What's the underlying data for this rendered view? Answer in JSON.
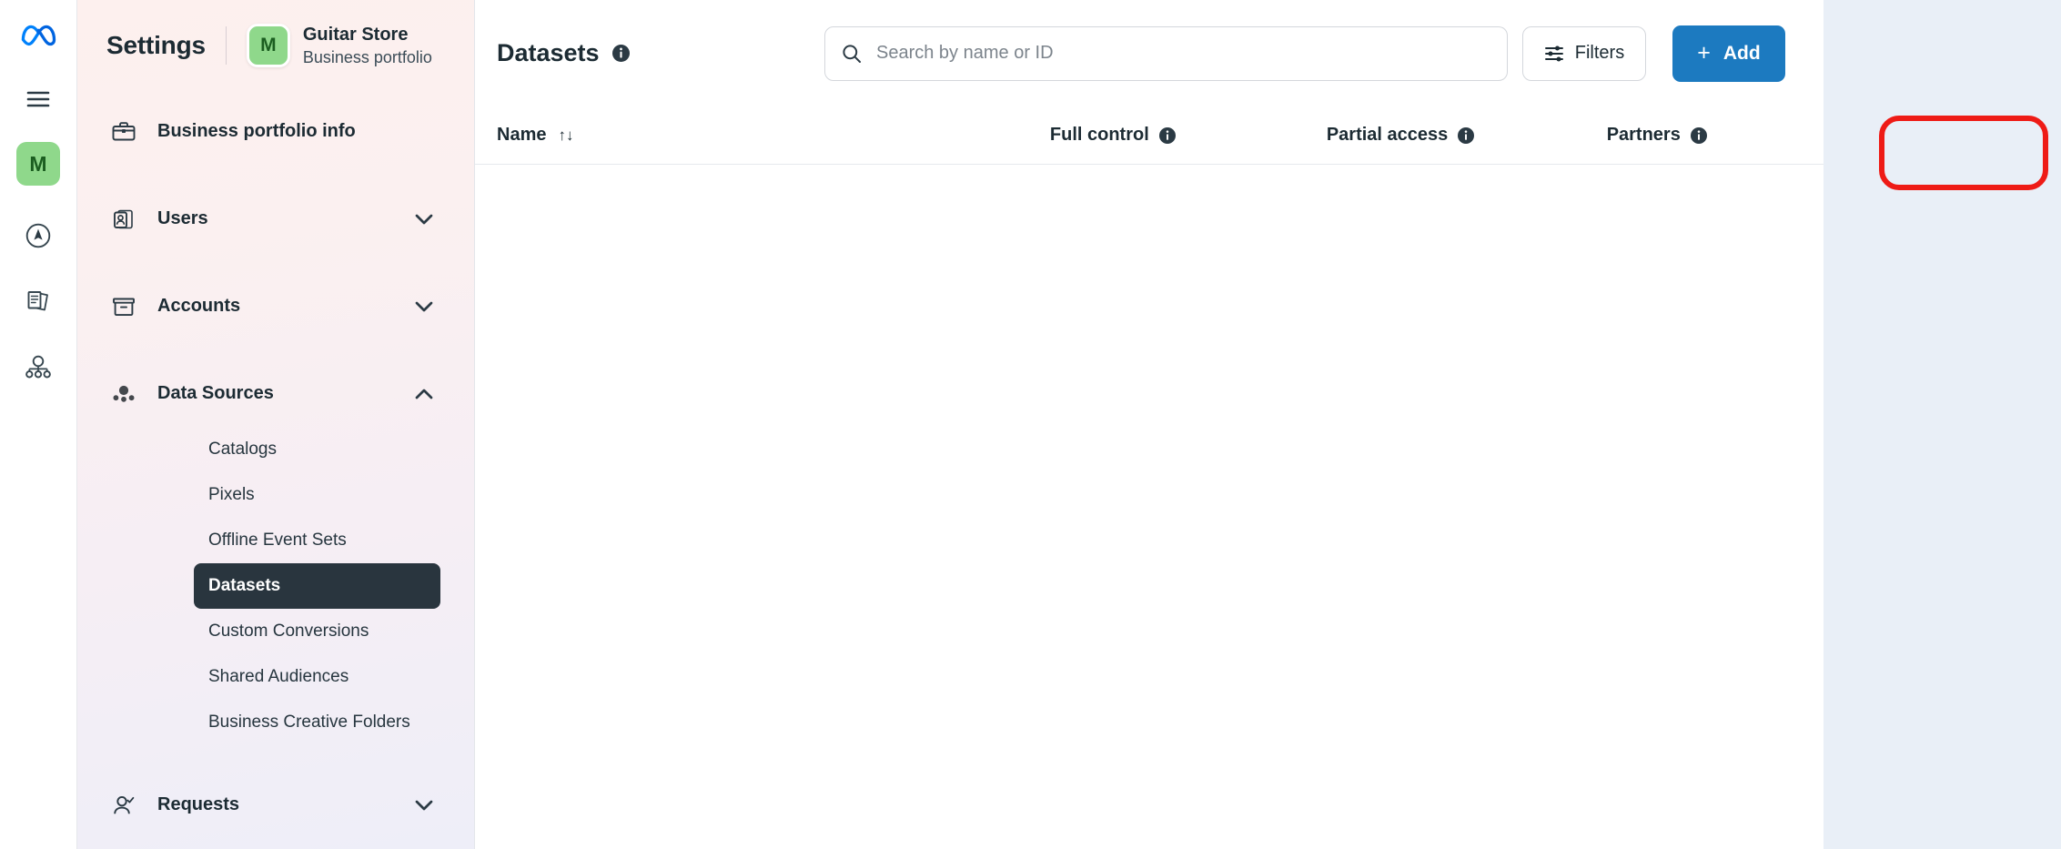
{
  "rail": {
    "logo": "meta-logo",
    "items": [
      {
        "name": "menu-icon",
        "label": "Menu"
      },
      {
        "name": "portfolio-avatar",
        "label": "M"
      },
      {
        "name": "compass-icon",
        "label": "Navigator"
      },
      {
        "name": "pages-icon",
        "label": "Pages"
      },
      {
        "name": "hierarchy-icon",
        "label": "Business structure"
      }
    ]
  },
  "header": {
    "title": "Settings",
    "portfolio_initial": "M",
    "portfolio_name": "Guitar Store",
    "portfolio_type": "Business portfolio"
  },
  "sidebar": {
    "items": [
      {
        "label": "Business portfolio info",
        "icon": "briefcase-icon",
        "expandable": false,
        "expanded": false
      },
      {
        "label": "Users",
        "icon": "id-card-icon",
        "expandable": true,
        "expanded": false
      },
      {
        "label": "Accounts",
        "icon": "box-icon",
        "expandable": true,
        "expanded": false
      },
      {
        "label": "Data Sources",
        "icon": "data-sources-icon",
        "expandable": true,
        "expanded": true
      },
      {
        "label": "Requests",
        "icon": "user-check-icon",
        "expandable": true,
        "expanded": false
      }
    ],
    "data_sources_children": [
      {
        "label": "Catalogs",
        "active": false
      },
      {
        "label": "Pixels",
        "active": false
      },
      {
        "label": "Offline Event Sets",
        "active": false
      },
      {
        "label": "Datasets",
        "active": true
      },
      {
        "label": "Custom Conversions",
        "active": false
      },
      {
        "label": "Shared Audiences",
        "active": false
      },
      {
        "label": "Business Creative Folders",
        "active": false
      }
    ]
  },
  "main": {
    "page_title": "Datasets",
    "search": {
      "placeholder": "Search by name or ID",
      "value": ""
    },
    "filters_label": "Filters",
    "add_label": "Add",
    "add_plus": "+",
    "table": {
      "columns": [
        {
          "label": "Name",
          "sortable": true,
          "sort_glyph": "↑↓",
          "has_info": false
        },
        {
          "label": "Full control",
          "sortable": false,
          "sort_glyph": "",
          "has_info": true
        },
        {
          "label": "Partial access",
          "sortable": false,
          "sort_glyph": "",
          "has_info": true
        },
        {
          "label": "Partners",
          "sortable": false,
          "sort_glyph": "",
          "has_info": true
        }
      ],
      "rows": []
    }
  },
  "annotation": {
    "shape": "rounded-rectangle",
    "color": "#ee1b16",
    "target": "add-button"
  },
  "colors": {
    "accent_blue": "#1c7ac0",
    "meta_blue": "#0081fb",
    "avatar_green": "#8fd88b",
    "active_nav": "#29353e",
    "page_bg": "#e9eff7",
    "sidebar_gradient_start": "#fdf0ee",
    "sidebar_gradient_end": "#eeeef8"
  }
}
